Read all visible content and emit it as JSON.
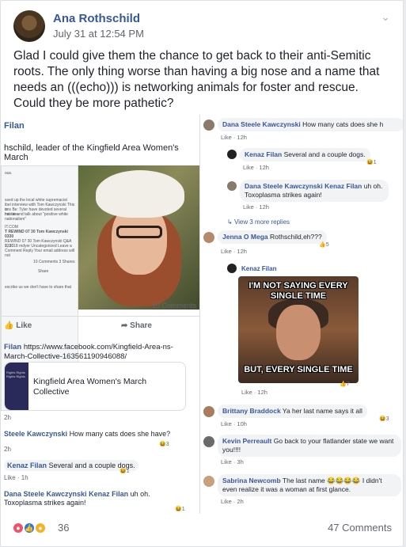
{
  "post": {
    "author": "Ana Rothschild",
    "timestamp": "July 31 at 12:54 PM",
    "text": "Glad I could give them the chance to get back to their anti-Semitic roots. The only thing worse than having a big nose and a name that needs an (((echo))) is networking animals for foster and rescue. Could they be more pathetic?"
  },
  "left_shot": {
    "name": "Filan",
    "text": "hschild, leader of the Kingfield Area Women's March",
    "preview_lines": [
      "ous.",
      "ssed up the local white supremacist",
      "ibel interview with Tom Kawczynski This is",
      "ons Be: Tyler have devoted several minutes",
      "hat he and talk about \"positive white",
      "nationalism\"",
      "IT.COM",
      "T REWIND 07 30 Tom Kawczynski",
      "0330",
      "REWIND 07 30 Tom Kawczynski Q&A 1330",
      "0, 2018 mdyer Uncategorized Leave a",
      "Comment Reply Your email address will not",
      "10 Comments  3 Shares",
      "Share",
      "escribe us we don't have to share that"
    ],
    "comments_count": "10 Comments",
    "like": "Like",
    "share": "Share",
    "link_comment_name": "Filan",
    "link_comment_text": "https://www.facebook.com/Kingfield-Area-ns-March-Collective-163561190946088/",
    "link_card_title": "Kingfield Area Women's March Collective",
    "link_thumb_text": "Rights Rights Rights Rights",
    "comments": [
      {
        "meta": "2h"
      },
      {
        "name": "Steele Kawczynski",
        "text": "How many cats does she have?",
        "meta": "2h",
        "react": "3"
      },
      {
        "name": "Kenaz Filan",
        "text": "Several and a couple dogs.",
        "meta": "Like · 1h",
        "react": "1"
      },
      {
        "name": "Dana Steele Kawczynski",
        "mention": "Kenaz Filan",
        "text": "uh oh. Toxoplasma strikes again!",
        "react": "1"
      }
    ]
  },
  "right_shot": {
    "comments": [
      {
        "name": "Dana Steele Kawczynski",
        "text": "How many cats does she h",
        "meta": "Like · 12h"
      },
      {
        "name": "Kenaz Filan",
        "text": "Several and a couple dogs.",
        "meta": "Like · 12h",
        "react": "1"
      },
      {
        "name": "Dana Steele Kawczynski",
        "mention": "Kenaz Filan",
        "text": "uh oh. Toxoplasma strikes again!",
        "meta": "Like · 12h"
      },
      {
        "name": "Jenna O Mega",
        "text": "Rothschild,eh???",
        "meta": "Like · 12h",
        "react": "5"
      },
      {
        "name": "Kenaz Filan"
      },
      {
        "name": "Brittany Braddock",
        "text": "Ya her last name says it all",
        "meta": "Like · 10h",
        "react": "3"
      },
      {
        "name": "Kevin Perreault",
        "text": "Go back to your flatlander state we want you!!!!",
        "meta": "Like · 3h"
      },
      {
        "name": "Sabrina Newcomb",
        "text": "The last name 😂😂😂😂 I didn't even realize it was a woman at first glance.",
        "meta": "Like · 2h"
      }
    ],
    "more_replies": "View 3 more replies",
    "meme": {
      "top": "I'M NOT SAYING EVERY SINGLE TIME",
      "bottom": "BUT, EVERY SINGLE TIME",
      "meta": "Like · 12h",
      "react": "7"
    }
  },
  "footer": {
    "reactions_count": "36",
    "comments_count": "47 Comments",
    "reaction_colors": [
      "#f25268",
      "#2078f4",
      "#f7b125"
    ]
  }
}
